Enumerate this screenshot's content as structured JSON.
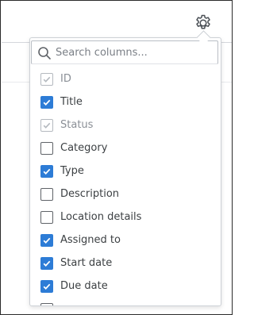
{
  "toolbar": {
    "settings_icon": "gear-icon"
  },
  "columns_menu": {
    "search": {
      "placeholder": "Search columns...",
      "value": "",
      "icon": "search-icon"
    },
    "colors": {
      "accent": "#2d7cd6",
      "disabled_check": "#b4b9bf",
      "text": "#3c4043",
      "disabled_text": "#8a8f96"
    },
    "items": [
      {
        "label": "ID",
        "checked": true,
        "disabled": true
      },
      {
        "label": "Title",
        "checked": true,
        "disabled": false
      },
      {
        "label": "Status",
        "checked": true,
        "disabled": true
      },
      {
        "label": "Category",
        "checked": false,
        "disabled": false
      },
      {
        "label": "Type",
        "checked": true,
        "disabled": false
      },
      {
        "label": "Description",
        "checked": false,
        "disabled": false
      },
      {
        "label": "Location details",
        "checked": false,
        "disabled": false
      },
      {
        "label": "Assigned to",
        "checked": true,
        "disabled": false
      },
      {
        "label": "Start date",
        "checked": true,
        "disabled": false
      },
      {
        "label": "Due date",
        "checked": true,
        "disabled": false
      },
      {
        "label": "",
        "checked": false,
        "disabled": false
      }
    ]
  }
}
